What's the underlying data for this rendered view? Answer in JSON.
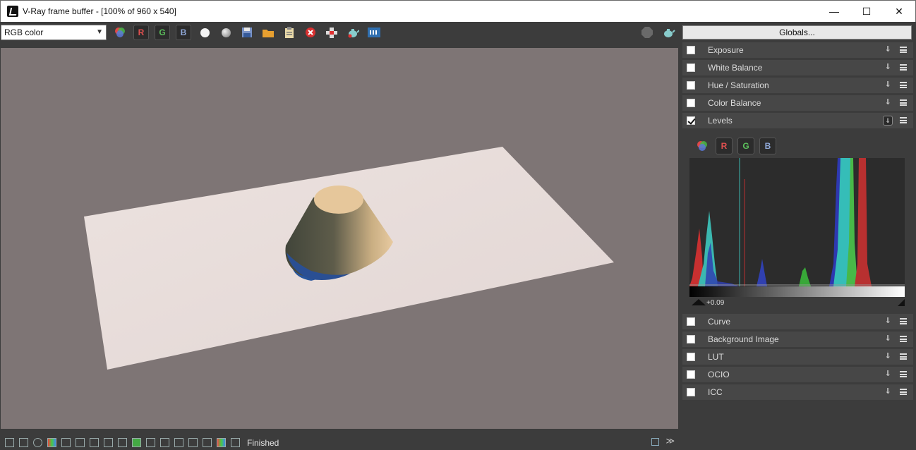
{
  "window": {
    "title": "V-Ray frame buffer - [100% of 960 x 540]",
    "controls": {
      "minimize": "—",
      "maximize": "☐",
      "close": "✕"
    }
  },
  "toolbar": {
    "channel_select": "RGB color",
    "channel_buttons": {
      "r": "R",
      "g": "G",
      "b": "B"
    },
    "icons": [
      "color-channels-icon",
      "red-channel-icon",
      "green-channel-icon",
      "blue-channel-icon",
      "white-circle-icon",
      "gray-circle-icon",
      "save-icon",
      "open-folder-icon",
      "clipboard-icon",
      "clear-icon",
      "region-icon",
      "teapot-icon",
      "track-mouse-icon",
      "stop-icon",
      "render-teapot-icon"
    ]
  },
  "panel": {
    "globals_label": "Globals...",
    "sections": {
      "exposure": "Exposure",
      "white_balance": "White Balance",
      "hue_saturation": "Hue / Saturation",
      "color_balance": "Color Balance",
      "levels": "Levels",
      "curve": "Curve",
      "background_image": "Background Image",
      "lut": "LUT",
      "ocio": "OCIO",
      "icc": "ICC"
    },
    "levels": {
      "channel_buttons": {
        "r": "R",
        "g": "G",
        "b": "B"
      },
      "input_value": "+0.09"
    }
  },
  "status": {
    "text": "Finished",
    "chevron": "≫"
  },
  "colors": {
    "red": "#e05050",
    "green": "#5cc05c",
    "blue": "#8fa8d8",
    "cyan": "#2ec4c4",
    "viewport_bg": "#7e7575"
  }
}
